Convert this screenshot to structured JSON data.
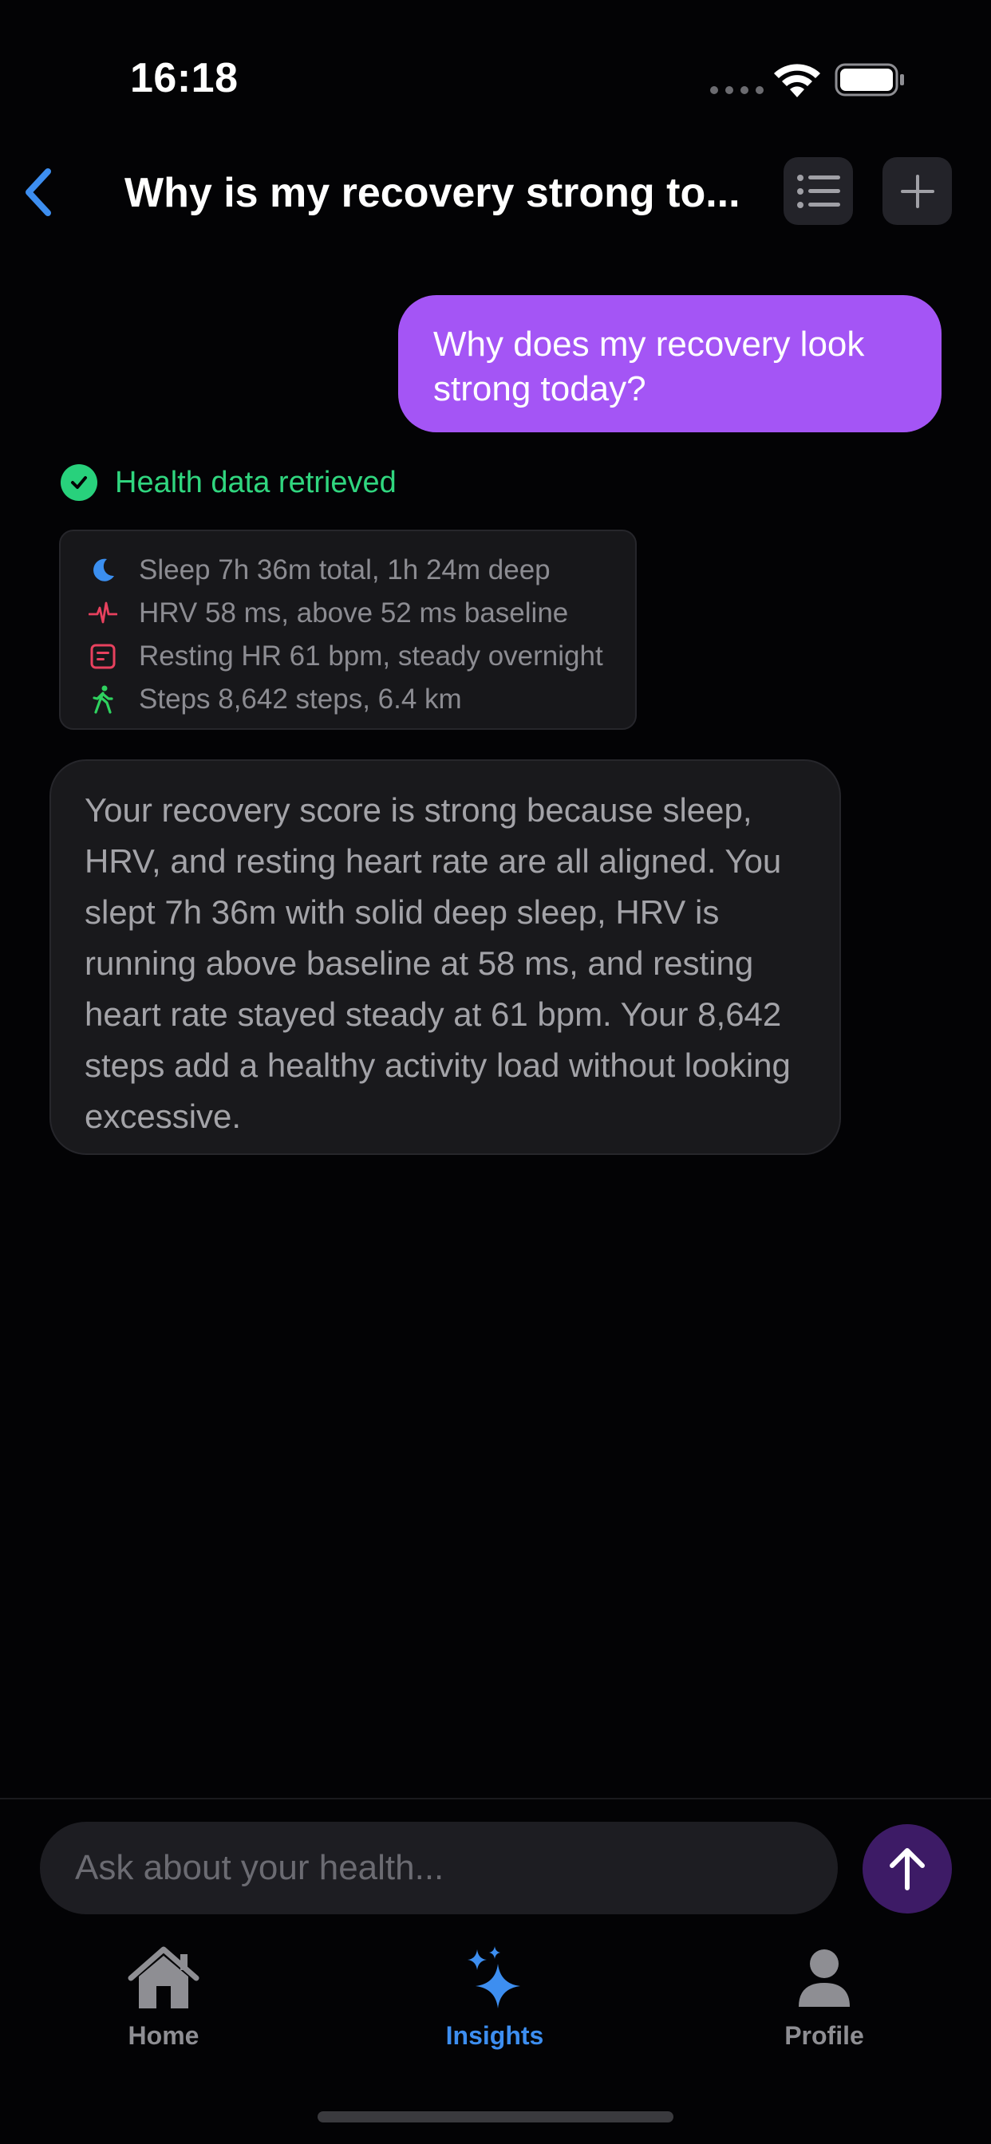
{
  "status_bar": {
    "time": "16:18"
  },
  "header": {
    "title": "Why is my recovery strong to..."
  },
  "chat": {
    "user_message": "Why does my recovery look strong today?",
    "tool_status": "Health data retrieved",
    "metrics": [
      {
        "icon": "moon-icon",
        "text": "Sleep 7h 36m total, 1h 24m deep",
        "color": "#3b8ff0"
      },
      {
        "icon": "heartbeat-icon",
        "text": "HRV 58 ms, above 52 ms baseline",
        "color": "#e8415e"
      },
      {
        "icon": "heart-rate-monitor-icon",
        "text": "Resting HR 61 bpm, steady overnight",
        "color": "#e8415e"
      },
      {
        "icon": "walking-icon",
        "text": "Steps 8,642 steps, 6.4 km",
        "color": "#2fd15f"
      }
    ],
    "assistant_message": "Your recovery score is strong because sleep, HRV, and resting heart rate are all aligned. You slept 7h 36m with solid deep sleep, HRV is running above baseline at 58 ms, and resting heart rate stayed steady at 61 bpm. Your 8,642 steps add a healthy activity load without looking excessive."
  },
  "input": {
    "placeholder": "Ask about your health..."
  },
  "tabs": [
    {
      "label": "Home",
      "icon": "house-icon",
      "active": false
    },
    {
      "label": "Insights",
      "icon": "sparkles-icon",
      "active": true
    },
    {
      "label": "Profile",
      "icon": "person-icon",
      "active": false
    }
  ],
  "colors": {
    "accent": "#a455f5",
    "link_blue": "#3d8ef0",
    "success_green": "#30d67f",
    "background": "#030305"
  }
}
